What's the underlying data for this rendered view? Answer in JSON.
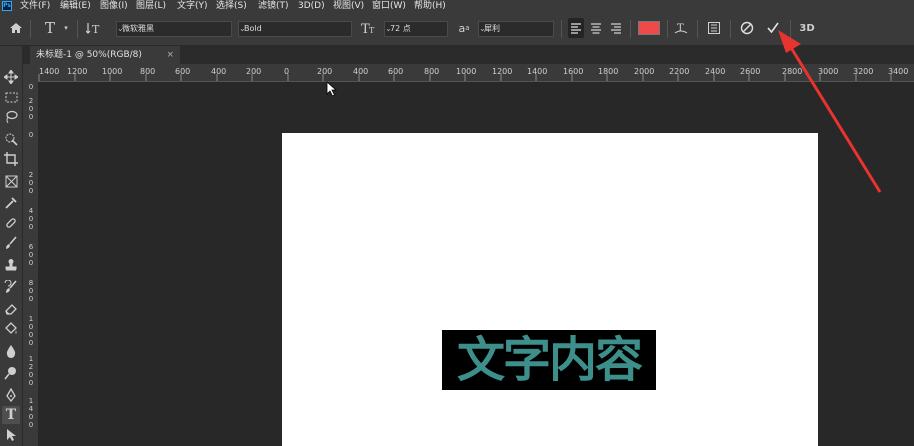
{
  "menubar": {
    "logo": "Ps",
    "items": [
      "文件(F)",
      "编辑(E)",
      "图像(I)",
      "图层(L)",
      "文字(Y)",
      "选择(S)",
      "滤镜(T)",
      "3D(D)",
      "视图(V)",
      "窗口(W)",
      "帮助(H)"
    ]
  },
  "options": {
    "font_family": "微软雅黑",
    "font_style": "Bold",
    "font_size": "72 点",
    "aa_label": "a",
    "aa_sup": "a",
    "antialias": "犀利",
    "text_color": "#ef4a4a",
    "threed_label": "3D"
  },
  "tab": {
    "title": "未标题-1 @ 50%(RGB/8)",
    "close": "×"
  },
  "ruler": {
    "h_labels": [
      "1400",
      "1200",
      "1000",
      "800",
      "600",
      "400",
      "200",
      "0",
      "200",
      "400",
      "600",
      "800",
      "1000",
      "1200",
      "1400",
      "1600",
      "1800",
      "2000",
      "2200",
      "2400",
      "2600",
      "2800",
      "3000",
      "3200",
      "3400"
    ],
    "v_labels": [
      "0",
      "200",
      "0",
      "200",
      "400",
      "600",
      "800",
      "1000",
      "1200",
      "1400"
    ]
  },
  "canvas": {
    "text": "文字内容",
    "text_color": "#3d8f8c"
  },
  "annotation_color": "#e8332f"
}
